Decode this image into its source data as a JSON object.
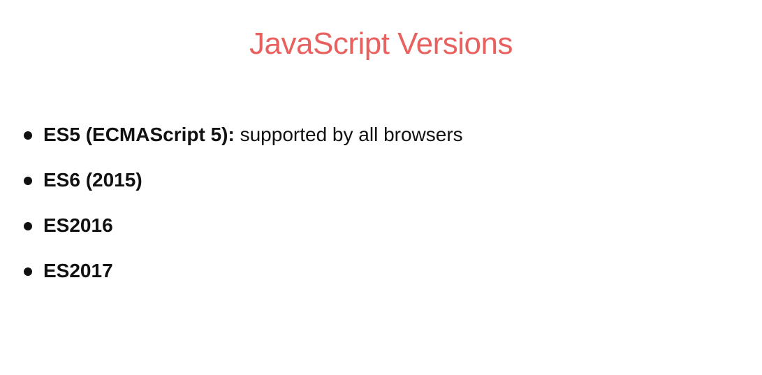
{
  "slide": {
    "title": "JavaScript Versions",
    "title_color": "#e8615f",
    "bullets": [
      {
        "strong": "ES5 (ECMAScript 5):",
        "rest": " supported by all browsers"
      },
      {
        "strong": "ES6 (2015)",
        "rest": ""
      },
      {
        "strong": "ES2016",
        "rest": ""
      },
      {
        "strong": "ES2017",
        "rest": ""
      }
    ]
  }
}
